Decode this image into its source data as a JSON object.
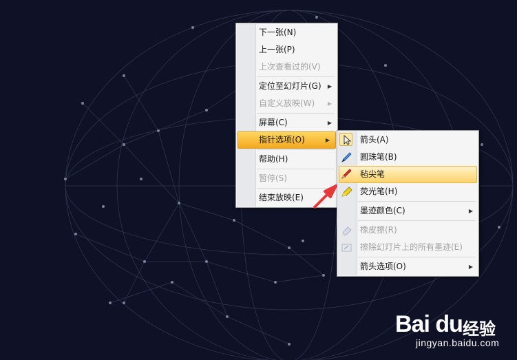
{
  "colors": {
    "background": "#0f1226",
    "menu_bg": "#f5f5f5",
    "highlight": "#ffd36b",
    "annotation_arrow": "#e8393a"
  },
  "context_menu": {
    "items": [
      {
        "label": "下一张(N)",
        "enabled": true,
        "submenu": false
      },
      {
        "label": "上一张(P)",
        "enabled": true,
        "submenu": false
      },
      {
        "label": "上次查看过的(V)",
        "enabled": false,
        "submenu": false
      },
      {
        "label": "定位至幻灯片(G)",
        "enabled": true,
        "submenu": true
      },
      {
        "label": "自定义放映(W)",
        "enabled": false,
        "submenu": true
      },
      {
        "label": "屏幕(C)",
        "enabled": true,
        "submenu": true
      },
      {
        "label": "指针选项(O)",
        "enabled": true,
        "submenu": true,
        "active": true
      },
      {
        "label": "帮助(H)",
        "enabled": true,
        "submenu": false
      },
      {
        "label": "暂停(S)",
        "enabled": false,
        "submenu": false
      },
      {
        "label": "结束放映(E)",
        "enabled": true,
        "submenu": false
      }
    ]
  },
  "pointer_submenu": {
    "items": [
      {
        "label": "箭头(A)",
        "icon": "cursor-arrow-icon",
        "checked": true,
        "enabled": true
      },
      {
        "label": "圆珠笔(B)",
        "icon": "ballpoint-pen-icon",
        "enabled": true
      },
      {
        "label": "毡尖笔",
        "icon": "felt-tip-pen-icon",
        "enabled": true,
        "hovered": true
      },
      {
        "label": "荧光笔(H)",
        "icon": "highlighter-icon",
        "enabled": true
      },
      {
        "label": "墨迹颜色(C)",
        "enabled": true,
        "submenu": true
      },
      {
        "label": "橡皮擦(R)",
        "icon": "eraser-icon",
        "enabled": false
      },
      {
        "label": "擦除幻灯片上的所有墨迹(E)",
        "icon": "erase-all-icon",
        "enabled": false
      },
      {
        "label": "箭头选项(O)",
        "enabled": true,
        "submenu": true
      }
    ]
  },
  "watermark": {
    "logo": "Bai du",
    "logo_suffix": "经验",
    "url": "jingyan.baidu.com"
  }
}
